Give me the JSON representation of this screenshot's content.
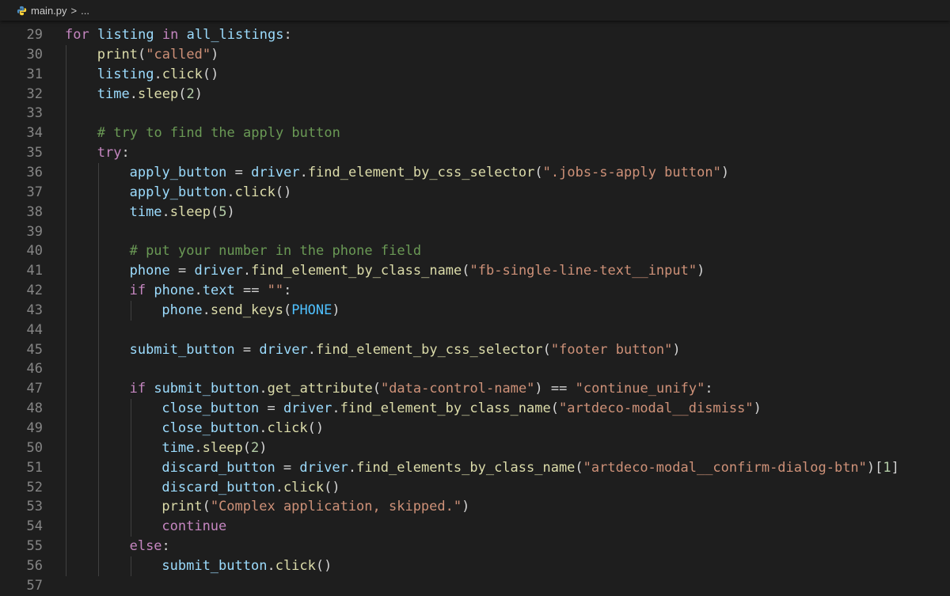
{
  "breadcrumb": {
    "file": "main.py",
    "separator": ">",
    "more": "..."
  },
  "lines": [
    {
      "n": "29",
      "indent": 0,
      "tokens": [
        [
          "kw",
          "for"
        ],
        [
          "op",
          " "
        ],
        [
          "var",
          "listing"
        ],
        [
          "op",
          " "
        ],
        [
          "kw",
          "in"
        ],
        [
          "op",
          " "
        ],
        [
          "var",
          "all_listings"
        ],
        [
          "op",
          ":"
        ]
      ]
    },
    {
      "n": "30",
      "indent": 1,
      "tokens": [
        [
          "fn",
          "print"
        ],
        [
          "op",
          "("
        ],
        [
          "str",
          "\"called\""
        ],
        [
          "op",
          ")"
        ]
      ]
    },
    {
      "n": "31",
      "indent": 1,
      "tokens": [
        [
          "var",
          "listing"
        ],
        [
          "op",
          "."
        ],
        [
          "fn",
          "click"
        ],
        [
          "op",
          "()"
        ]
      ]
    },
    {
      "n": "32",
      "indent": 1,
      "tokens": [
        [
          "var",
          "time"
        ],
        [
          "op",
          "."
        ],
        [
          "fn",
          "sleep"
        ],
        [
          "op",
          "("
        ],
        [
          "num",
          "2"
        ],
        [
          "op",
          ")"
        ]
      ]
    },
    {
      "n": "33",
      "indent": 0,
      "tokens": []
    },
    {
      "n": "34",
      "indent": 1,
      "tokens": [
        [
          "cmt",
          "# try to find the apply button"
        ]
      ]
    },
    {
      "n": "35",
      "indent": 1,
      "tokens": [
        [
          "kw",
          "try"
        ],
        [
          "op",
          ":"
        ]
      ]
    },
    {
      "n": "36",
      "indent": 2,
      "tokens": [
        [
          "var",
          "apply_button"
        ],
        [
          "op",
          " = "
        ],
        [
          "var",
          "driver"
        ],
        [
          "op",
          "."
        ],
        [
          "fn",
          "find_element_by_css_selector"
        ],
        [
          "op",
          "("
        ],
        [
          "str",
          "\".jobs-s-apply button\""
        ],
        [
          "op",
          ")"
        ]
      ]
    },
    {
      "n": "37",
      "indent": 2,
      "tokens": [
        [
          "var",
          "apply_button"
        ],
        [
          "op",
          "."
        ],
        [
          "fn",
          "click"
        ],
        [
          "op",
          "()"
        ]
      ]
    },
    {
      "n": "38",
      "indent": 2,
      "tokens": [
        [
          "var",
          "time"
        ],
        [
          "op",
          "."
        ],
        [
          "fn",
          "sleep"
        ],
        [
          "op",
          "("
        ],
        [
          "num",
          "5"
        ],
        [
          "op",
          ")"
        ]
      ]
    },
    {
      "n": "39",
      "indent": 0,
      "tokens": []
    },
    {
      "n": "40",
      "indent": 2,
      "tokens": [
        [
          "cmt",
          "# put your number in the phone field"
        ]
      ]
    },
    {
      "n": "41",
      "indent": 2,
      "tokens": [
        [
          "var",
          "phone"
        ],
        [
          "op",
          " = "
        ],
        [
          "var",
          "driver"
        ],
        [
          "op",
          "."
        ],
        [
          "fn",
          "find_element_by_class_name"
        ],
        [
          "op",
          "("
        ],
        [
          "str",
          "\"fb-single-line-text__input\""
        ],
        [
          "op",
          ")"
        ]
      ]
    },
    {
      "n": "42",
      "indent": 2,
      "tokens": [
        [
          "kw",
          "if"
        ],
        [
          "op",
          " "
        ],
        [
          "var",
          "phone"
        ],
        [
          "op",
          "."
        ],
        [
          "var",
          "text"
        ],
        [
          "op",
          " == "
        ],
        [
          "str",
          "\"\""
        ],
        [
          "op",
          ":"
        ]
      ]
    },
    {
      "n": "43",
      "indent": 3,
      "tokens": [
        [
          "var",
          "phone"
        ],
        [
          "op",
          "."
        ],
        [
          "fn",
          "send_keys"
        ],
        [
          "op",
          "("
        ],
        [
          "cls",
          "PHONE"
        ],
        [
          "op",
          ")"
        ]
      ]
    },
    {
      "n": "44",
      "indent": 0,
      "tokens": []
    },
    {
      "n": "45",
      "indent": 2,
      "tokens": [
        [
          "var",
          "submit_button"
        ],
        [
          "op",
          " = "
        ],
        [
          "var",
          "driver"
        ],
        [
          "op",
          "."
        ],
        [
          "fn",
          "find_element_by_css_selector"
        ],
        [
          "op",
          "("
        ],
        [
          "str",
          "\"footer button\""
        ],
        [
          "op",
          ")"
        ]
      ]
    },
    {
      "n": "46",
      "indent": 0,
      "tokens": []
    },
    {
      "n": "47",
      "indent": 2,
      "tokens": [
        [
          "kw",
          "if"
        ],
        [
          "op",
          " "
        ],
        [
          "var",
          "submit_button"
        ],
        [
          "op",
          "."
        ],
        [
          "fn",
          "get_attribute"
        ],
        [
          "op",
          "("
        ],
        [
          "str",
          "\"data-control-name\""
        ],
        [
          "op",
          ") == "
        ],
        [
          "str",
          "\"continue_unify\""
        ],
        [
          "op",
          ":"
        ]
      ]
    },
    {
      "n": "48",
      "indent": 3,
      "tokens": [
        [
          "var",
          "close_button"
        ],
        [
          "op",
          " = "
        ],
        [
          "var",
          "driver"
        ],
        [
          "op",
          "."
        ],
        [
          "fn",
          "find_element_by_class_name"
        ],
        [
          "op",
          "("
        ],
        [
          "str",
          "\"artdeco-modal__dismiss\""
        ],
        [
          "op",
          ")"
        ]
      ]
    },
    {
      "n": "49",
      "indent": 3,
      "tokens": [
        [
          "var",
          "close_button"
        ],
        [
          "op",
          "."
        ],
        [
          "fn",
          "click"
        ],
        [
          "op",
          "()"
        ]
      ]
    },
    {
      "n": "50",
      "indent": 3,
      "tokens": [
        [
          "var",
          "time"
        ],
        [
          "op",
          "."
        ],
        [
          "fn",
          "sleep"
        ],
        [
          "op",
          "("
        ],
        [
          "num",
          "2"
        ],
        [
          "op",
          ")"
        ]
      ]
    },
    {
      "n": "51",
      "indent": 3,
      "tokens": [
        [
          "var",
          "discard_button"
        ],
        [
          "op",
          " = "
        ],
        [
          "var",
          "driver"
        ],
        [
          "op",
          "."
        ],
        [
          "fn",
          "find_elements_by_class_name"
        ],
        [
          "op",
          "("
        ],
        [
          "str",
          "\"artdeco-modal__confirm-dialog-btn\""
        ],
        [
          "op",
          ")["
        ],
        [
          "num",
          "1"
        ],
        [
          "op",
          "]"
        ]
      ]
    },
    {
      "n": "52",
      "indent": 3,
      "tokens": [
        [
          "var",
          "discard_button"
        ],
        [
          "op",
          "."
        ],
        [
          "fn",
          "click"
        ],
        [
          "op",
          "()"
        ]
      ]
    },
    {
      "n": "53",
      "indent": 3,
      "tokens": [
        [
          "fn",
          "print"
        ],
        [
          "op",
          "("
        ],
        [
          "str",
          "\"Complex application, skipped.\""
        ],
        [
          "op",
          ")"
        ]
      ]
    },
    {
      "n": "54",
      "indent": 3,
      "tokens": [
        [
          "kw",
          "continue"
        ]
      ]
    },
    {
      "n": "55",
      "indent": 2,
      "tokens": [
        [
          "kw",
          "else"
        ],
        [
          "op",
          ":"
        ]
      ]
    },
    {
      "n": "56",
      "indent": 3,
      "tokens": [
        [
          "var",
          "submit_button"
        ],
        [
          "op",
          "."
        ],
        [
          "fn",
          "click"
        ],
        [
          "op",
          "()"
        ]
      ]
    },
    {
      "n": "57",
      "indent": 0,
      "tokens": []
    }
  ],
  "colors": {
    "background": "#1e1e1e",
    "keyword": "#c586c0",
    "function": "#dcdcaa",
    "string": "#ce9178",
    "number": "#b5cea8",
    "comment": "#6a9955",
    "variable": "#9cdcfe",
    "constant": "#4fc1ff",
    "line_number": "#858585"
  }
}
